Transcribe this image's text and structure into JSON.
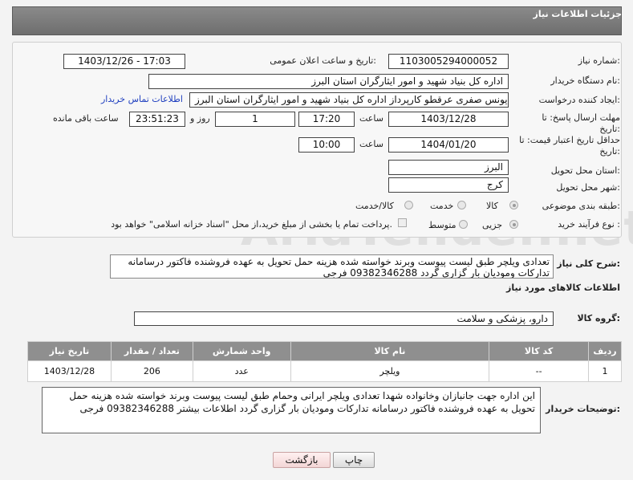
{
  "header": {
    "title": "جزئیات اطلاعات نیاز"
  },
  "form": {
    "need_number": {
      "label": "شماره نیاز:",
      "value": "1103005294000052"
    },
    "announce_datetime": {
      "label": "تاریخ و ساعت اعلان عمومی:",
      "value": "1403/12/26 - 17:03"
    },
    "buyer_org": {
      "label": "نام دستگاه خریدار:",
      "value": "اداره کل بنیاد شهید و امور ایثارگران استان البرز"
    },
    "requester": {
      "label": "ایجاد کننده درخواست:",
      "value": "یونس  صفری عرقطو کارپرداز اداره کل بنیاد شهید و امور ایثارگران استان البرز",
      "contact_link": "اطلاعات تماس خریدار"
    },
    "reply_deadline": {
      "label": "مهلت ارسال پاسخ: تا تاریخ:",
      "date": "1403/12/28",
      "time_label": "ساعت",
      "time": "17:20",
      "days": "1",
      "days_label": "روز و",
      "remaining": "23:51:23",
      "remaining_label": "ساعت باقی مانده"
    },
    "price_validity": {
      "label": "حداقل تاریخ اعتبار قیمت: تا تاریخ:",
      "date": "1404/01/20",
      "time_label": "ساعت",
      "time": "10:00"
    },
    "province": {
      "label": "استان محل تحویل:",
      "value": "البرز"
    },
    "city": {
      "label": "شهر محل تحویل:",
      "value": "کرج"
    },
    "category": {
      "label": "طبقه بندی موضوعی:",
      "options": [
        "کالا",
        "خدمت",
        "کالا/خدمت"
      ],
      "selected": "کالا"
    },
    "purchase_type": {
      "label": "نوع فرآیند خرید :",
      "options": [
        "جزیی",
        "متوسط"
      ],
      "selected": "جزیی",
      "payment_note": "پرداخت تمام یا بخشی از مبلغ خرید،از محل \"اسناد خزانه اسلامی\" خواهد بود."
    }
  },
  "description": {
    "label": "شرح کلی نیاز:",
    "text": "تعدادی ویلچر  طبق  لیست پیوست وبرند خواسته شده هزینه حمل تحویل به عهده فروشنده فاکتور درسامانه تدارکات ومودیان بار گزاری گردد  09382346288 فرجی"
  },
  "goods_section": {
    "title": "اطلاعات کالاهای مورد نیاز",
    "group_label": "گروه کالا:",
    "group_value": "دارو، پزشکی و سلامت"
  },
  "table": {
    "headers": [
      "ردیف",
      "کد کالا",
      "نام کالا",
      "واحد شمارش",
      "تعداد / مقدار",
      "تاریخ نیاز"
    ],
    "rows": [
      [
        "1",
        "--",
        "ویلچر",
        "عدد",
        "206",
        "1403/12/28"
      ]
    ]
  },
  "buyer_notes": {
    "label": "توضیحات خریدار:",
    "text": "این اداره جهت جانبازان وخانواده شهدا تعدادی ویلچر ایرانی وحمام   طبق  لیست پیوست وبرند خواسته شده هزینه حمل تحویل به عهده فروشنده فاکتور درسامانه تدارکات ومودیان بار گزاری گردد اطلاعات بیشتر 09382346288 فرجی"
  },
  "buttons": {
    "print": "چاپ",
    "back": "بازگشت"
  },
  "watermark": "AriaTender.net"
}
